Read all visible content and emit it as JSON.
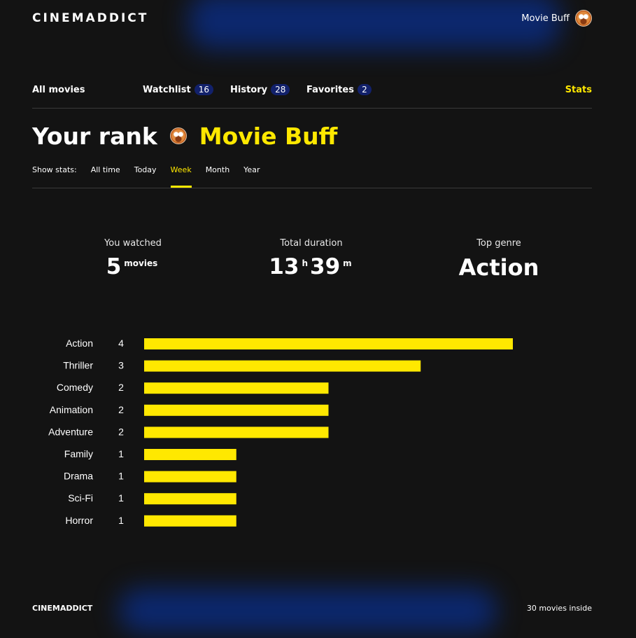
{
  "header": {
    "logo": "CINEMADDICT",
    "profile_name": "Movie Buff",
    "avatar_icon": "user-avatar-icon"
  },
  "nav": {
    "all_movies": "All movies",
    "watchlist": {
      "label": "Watchlist",
      "count": "16"
    },
    "history": {
      "label": "History",
      "count": "28"
    },
    "favorites": {
      "label": "Favorites",
      "count": "2"
    },
    "stats": "Stats"
  },
  "rank": {
    "label": "Your rank",
    "name": "Movie Buff"
  },
  "filters": {
    "label": "Show stats:",
    "options": [
      "All time",
      "Today",
      "Week",
      "Month",
      "Year"
    ],
    "active": "Week"
  },
  "stats": {
    "watched": {
      "label": "You watched",
      "value": "5",
      "unit": "movies"
    },
    "duration": {
      "label": "Total duration",
      "hours": "13",
      "hours_unit": "h",
      "minutes": "39",
      "minutes_unit": "m"
    },
    "top_genre": {
      "label": "Top genre",
      "value": "Action"
    }
  },
  "chart_data": {
    "type": "bar",
    "orientation": "horizontal",
    "categories": [
      "Action",
      "Thriller",
      "Comedy",
      "Animation",
      "Adventure",
      "Family",
      "Drama",
      "Sci-Fi",
      "Horror"
    ],
    "values": [
      4,
      3,
      2,
      2,
      2,
      1,
      1,
      1,
      1
    ],
    "xlim": [
      0,
      4
    ],
    "grid": false,
    "bar_color": "#ffe800"
  },
  "footer": {
    "logo": "CINEMADDICT",
    "count": "30 movies inside"
  },
  "colors": {
    "background": "#131313",
    "accent": "#ffe800",
    "badge": "#12216b"
  }
}
